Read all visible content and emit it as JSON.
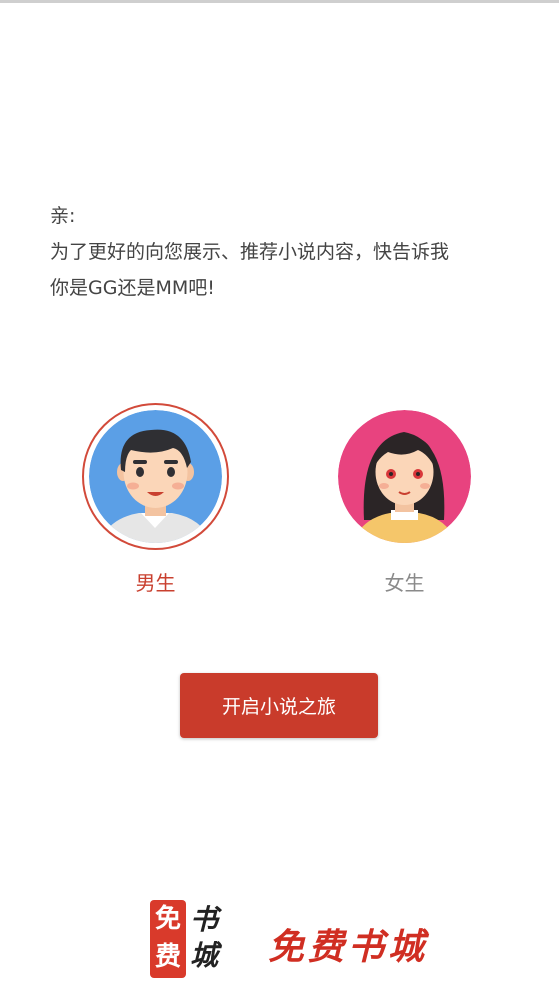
{
  "greeting": {
    "line1": "亲:",
    "line2": "为了更好的向您展示、推荐小说内容，快告诉我",
    "line3": "你是GG还是MM吧!"
  },
  "genders": {
    "male_label": "男生",
    "female_label": "女生",
    "selected": "male"
  },
  "start_button_label": "开启小说之旅",
  "logo": {
    "box_chars": [
      "免",
      "费"
    ],
    "side_chars": [
      "书",
      "城"
    ],
    "text": "免费书城"
  },
  "colors": {
    "accent": "#c93b2b",
    "male_avatar_bg": "#5b9fe6",
    "female_avatar_bg": "#e8437f",
    "unselected_text": "#8a8a8a"
  }
}
